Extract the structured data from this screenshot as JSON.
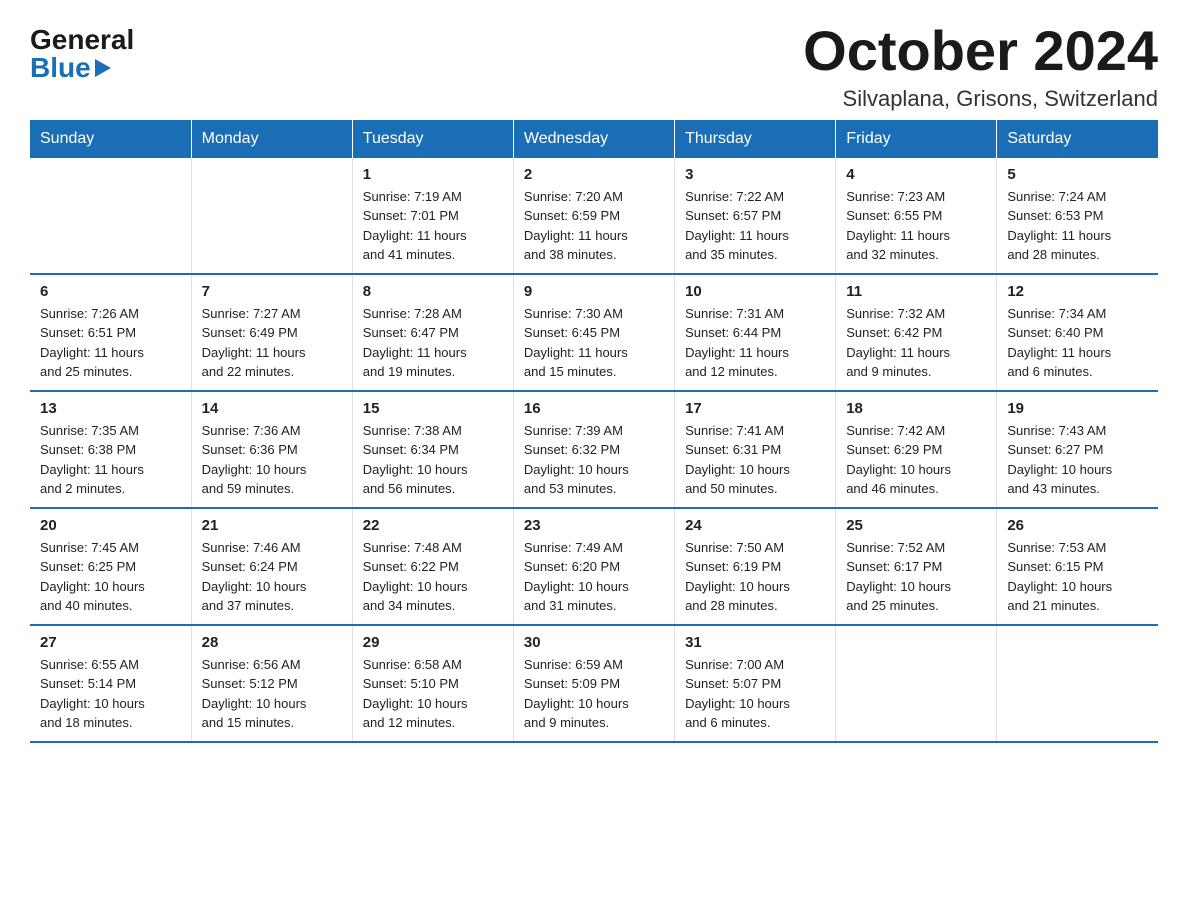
{
  "logo": {
    "general": "General",
    "blue": "Blue"
  },
  "title": "October 2024",
  "location": "Silvaplana, Grisons, Switzerland",
  "headers": [
    "Sunday",
    "Monday",
    "Tuesday",
    "Wednesday",
    "Thursday",
    "Friday",
    "Saturday"
  ],
  "weeks": [
    [
      {
        "day": "",
        "info": ""
      },
      {
        "day": "",
        "info": ""
      },
      {
        "day": "1",
        "info": "Sunrise: 7:19 AM\nSunset: 7:01 PM\nDaylight: 11 hours\nand 41 minutes."
      },
      {
        "day": "2",
        "info": "Sunrise: 7:20 AM\nSunset: 6:59 PM\nDaylight: 11 hours\nand 38 minutes."
      },
      {
        "day": "3",
        "info": "Sunrise: 7:22 AM\nSunset: 6:57 PM\nDaylight: 11 hours\nand 35 minutes."
      },
      {
        "day": "4",
        "info": "Sunrise: 7:23 AM\nSunset: 6:55 PM\nDaylight: 11 hours\nand 32 minutes."
      },
      {
        "day": "5",
        "info": "Sunrise: 7:24 AM\nSunset: 6:53 PM\nDaylight: 11 hours\nand 28 minutes."
      }
    ],
    [
      {
        "day": "6",
        "info": "Sunrise: 7:26 AM\nSunset: 6:51 PM\nDaylight: 11 hours\nand 25 minutes."
      },
      {
        "day": "7",
        "info": "Sunrise: 7:27 AM\nSunset: 6:49 PM\nDaylight: 11 hours\nand 22 minutes."
      },
      {
        "day": "8",
        "info": "Sunrise: 7:28 AM\nSunset: 6:47 PM\nDaylight: 11 hours\nand 19 minutes."
      },
      {
        "day": "9",
        "info": "Sunrise: 7:30 AM\nSunset: 6:45 PM\nDaylight: 11 hours\nand 15 minutes."
      },
      {
        "day": "10",
        "info": "Sunrise: 7:31 AM\nSunset: 6:44 PM\nDaylight: 11 hours\nand 12 minutes."
      },
      {
        "day": "11",
        "info": "Sunrise: 7:32 AM\nSunset: 6:42 PM\nDaylight: 11 hours\nand 9 minutes."
      },
      {
        "day": "12",
        "info": "Sunrise: 7:34 AM\nSunset: 6:40 PM\nDaylight: 11 hours\nand 6 minutes."
      }
    ],
    [
      {
        "day": "13",
        "info": "Sunrise: 7:35 AM\nSunset: 6:38 PM\nDaylight: 11 hours\nand 2 minutes."
      },
      {
        "day": "14",
        "info": "Sunrise: 7:36 AM\nSunset: 6:36 PM\nDaylight: 10 hours\nand 59 minutes."
      },
      {
        "day": "15",
        "info": "Sunrise: 7:38 AM\nSunset: 6:34 PM\nDaylight: 10 hours\nand 56 minutes."
      },
      {
        "day": "16",
        "info": "Sunrise: 7:39 AM\nSunset: 6:32 PM\nDaylight: 10 hours\nand 53 minutes."
      },
      {
        "day": "17",
        "info": "Sunrise: 7:41 AM\nSunset: 6:31 PM\nDaylight: 10 hours\nand 50 minutes."
      },
      {
        "day": "18",
        "info": "Sunrise: 7:42 AM\nSunset: 6:29 PM\nDaylight: 10 hours\nand 46 minutes."
      },
      {
        "day": "19",
        "info": "Sunrise: 7:43 AM\nSunset: 6:27 PM\nDaylight: 10 hours\nand 43 minutes."
      }
    ],
    [
      {
        "day": "20",
        "info": "Sunrise: 7:45 AM\nSunset: 6:25 PM\nDaylight: 10 hours\nand 40 minutes."
      },
      {
        "day": "21",
        "info": "Sunrise: 7:46 AM\nSunset: 6:24 PM\nDaylight: 10 hours\nand 37 minutes."
      },
      {
        "day": "22",
        "info": "Sunrise: 7:48 AM\nSunset: 6:22 PM\nDaylight: 10 hours\nand 34 minutes."
      },
      {
        "day": "23",
        "info": "Sunrise: 7:49 AM\nSunset: 6:20 PM\nDaylight: 10 hours\nand 31 minutes."
      },
      {
        "day": "24",
        "info": "Sunrise: 7:50 AM\nSunset: 6:19 PM\nDaylight: 10 hours\nand 28 minutes."
      },
      {
        "day": "25",
        "info": "Sunrise: 7:52 AM\nSunset: 6:17 PM\nDaylight: 10 hours\nand 25 minutes."
      },
      {
        "day": "26",
        "info": "Sunrise: 7:53 AM\nSunset: 6:15 PM\nDaylight: 10 hours\nand 21 minutes."
      }
    ],
    [
      {
        "day": "27",
        "info": "Sunrise: 6:55 AM\nSunset: 5:14 PM\nDaylight: 10 hours\nand 18 minutes."
      },
      {
        "day": "28",
        "info": "Sunrise: 6:56 AM\nSunset: 5:12 PM\nDaylight: 10 hours\nand 15 minutes."
      },
      {
        "day": "29",
        "info": "Sunrise: 6:58 AM\nSunset: 5:10 PM\nDaylight: 10 hours\nand 12 minutes."
      },
      {
        "day": "30",
        "info": "Sunrise: 6:59 AM\nSunset: 5:09 PM\nDaylight: 10 hours\nand 9 minutes."
      },
      {
        "day": "31",
        "info": "Sunrise: 7:00 AM\nSunset: 5:07 PM\nDaylight: 10 hours\nand 6 minutes."
      },
      {
        "day": "",
        "info": ""
      },
      {
        "day": "",
        "info": ""
      }
    ]
  ]
}
